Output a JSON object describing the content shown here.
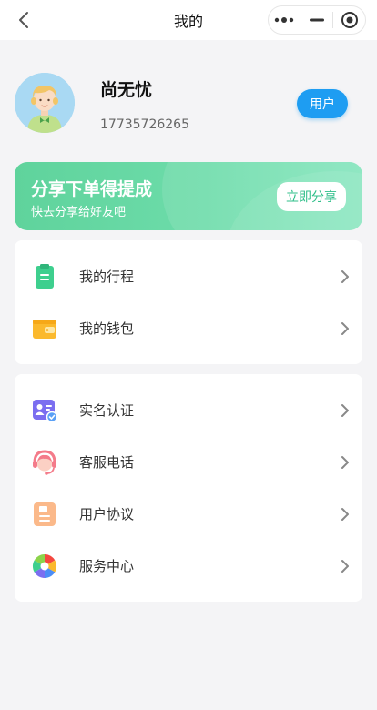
{
  "navbar": {
    "title": "我的"
  },
  "profile": {
    "name": "尚无忧",
    "phone": "17735726265",
    "role_button": "用户"
  },
  "banner": {
    "title": "分享下单得提成",
    "subtitle": "快去分享给好友吧",
    "button": "立即分享"
  },
  "menu_group_1": [
    {
      "label": "我的行程",
      "icon": "itinerary-icon"
    },
    {
      "label": "我的钱包",
      "icon": "wallet-icon"
    }
  ],
  "menu_group_2": [
    {
      "label": "实名认证",
      "icon": "id-verify-icon"
    },
    {
      "label": "客服电话",
      "icon": "customer-service-icon"
    },
    {
      "label": "用户协议",
      "icon": "agreement-icon"
    },
    {
      "label": "服务中心",
      "icon": "service-center-icon"
    }
  ],
  "colors": {
    "accent_blue": "#1e9df2",
    "banner_green": "#5fd39c",
    "background": "#f4f4f6"
  }
}
